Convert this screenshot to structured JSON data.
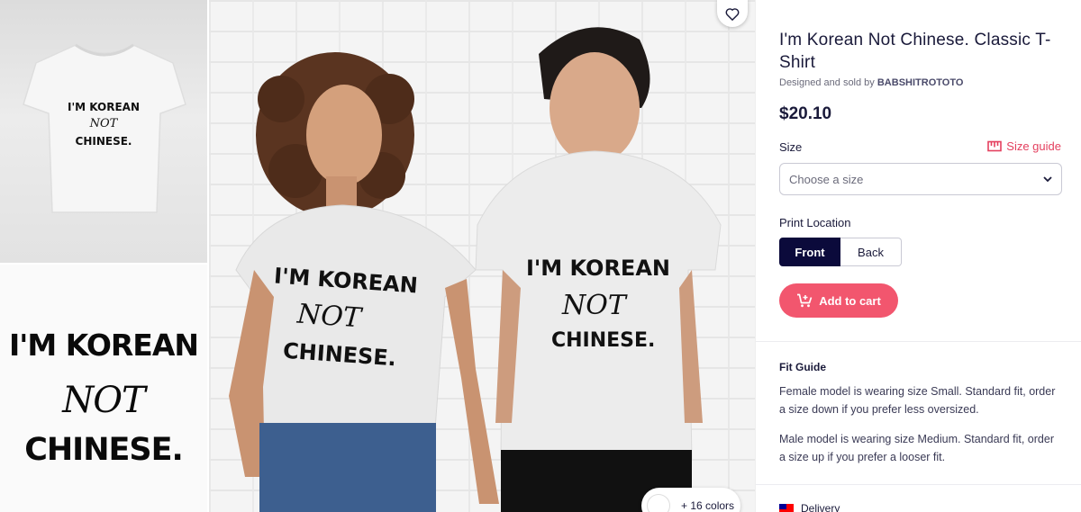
{
  "gallery": {
    "thumb1_lines": [
      "I'M KOREAN",
      "NOT",
      "CHINESE."
    ],
    "thumb2_lines": [
      "I'M KOREAN",
      "NOT",
      "CHINESE."
    ],
    "shirt_lines": [
      "I'M KOREAN",
      "NOT",
      "CHINESE."
    ],
    "colors_chip": "+ 16 colors"
  },
  "product": {
    "title": "I'm Korean Not Chinese. Classic T-Shirt",
    "designed_by_prefix": "Designed and sold by ",
    "designer": "BABSHITROTOTO",
    "price": "$20.10",
    "size_label": "Size",
    "size_guide": "Size guide",
    "size_placeholder": "Choose a size",
    "print_location_label": "Print Location",
    "print_options": [
      "Front",
      "Back"
    ],
    "add_to_cart": "Add to cart"
  },
  "fit_guide": {
    "title": "Fit Guide",
    "female": "Female model is wearing size Small. Standard fit, order a size down if you prefer less oversized.",
    "male": "Male model is wearing size Medium. Standard fit, order a size up if you prefer a looser fit."
  },
  "delivery": {
    "label": "Delivery"
  },
  "colors": {
    "accent": "#f2566e",
    "primary": "#0b0a3b"
  }
}
